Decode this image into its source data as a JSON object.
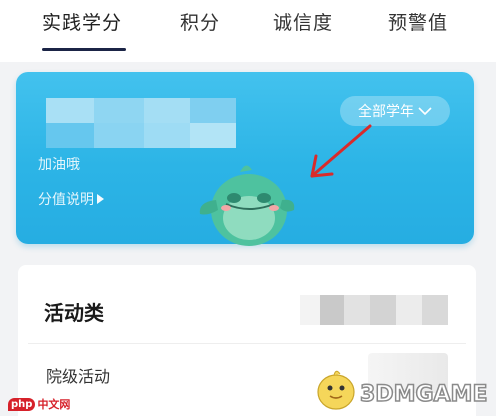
{
  "tabs": [
    {
      "label": "实践学分",
      "active": true
    },
    {
      "label": "积分",
      "active": false
    },
    {
      "label": "诚信度",
      "active": false
    },
    {
      "label": "预警值",
      "active": false
    }
  ],
  "card": {
    "user_text": "加油哦",
    "score_note": "分值说明",
    "year_select": "全部学年",
    "year_select_icon": "chevron-down-icon",
    "accent_color": "#2cb4e6"
  },
  "activity": {
    "title": "活动类",
    "rows": [
      {
        "label": "院级活动"
      }
    ]
  },
  "watermarks": {
    "left_badge": "php",
    "left_text": "中文网",
    "right_text": "3DMGAME"
  }
}
